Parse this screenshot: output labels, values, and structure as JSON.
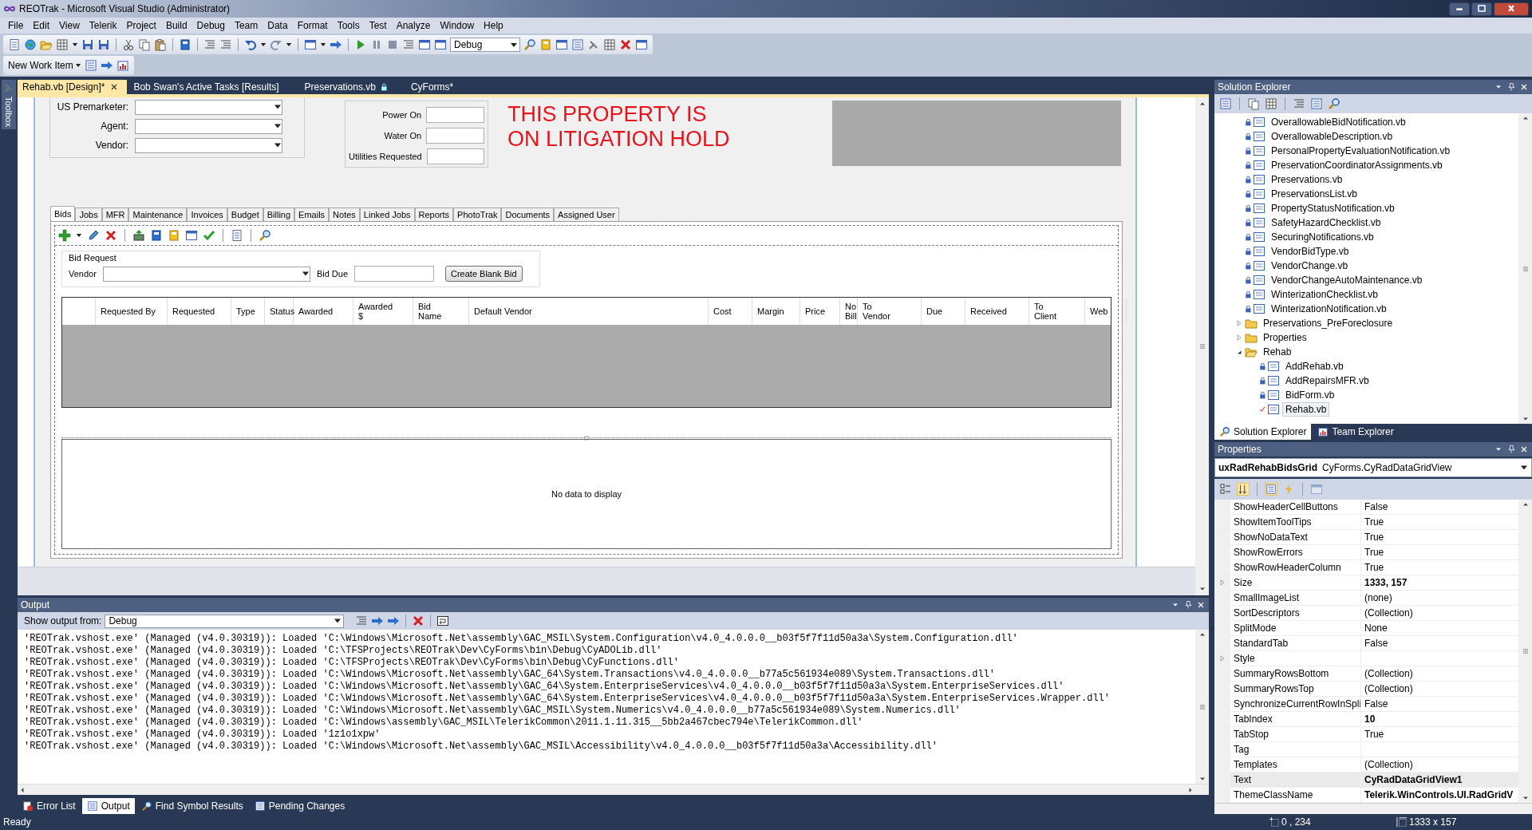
{
  "window": {
    "title": "REOTrak - Microsoft Visual Studio (Administrator)"
  },
  "menu": [
    "File",
    "Edit",
    "View",
    "Telerik",
    "Project",
    "Build",
    "Debug",
    "Team",
    "Data",
    "Format",
    "Tools",
    "Test",
    "Analyze",
    "Window",
    "Help"
  ],
  "toolbar": {
    "configuration": "Debug",
    "new_work_item": "New Work Item"
  },
  "toolbox": {
    "label": "Toolbox"
  },
  "document_tabs": [
    {
      "label": "Rehab.vb [Design]*",
      "selected": true,
      "locked": false
    },
    {
      "label": "Bob Swan's Active Tasks [Results]",
      "selected": false,
      "locked": false
    },
    {
      "label": "Preservations.vb",
      "selected": false,
      "locked": true
    },
    {
      "label": "CyForms*",
      "selected": false,
      "locked": false
    }
  ],
  "designer": {
    "assignment_fields": [
      "US Premarketer:",
      "Agent:",
      "Vendor:"
    ],
    "utility_fields": [
      "Power On",
      "Water On",
      "Utilities Requested"
    ],
    "alert": "THIS PROPERTY IS\nON LITIGATION HOLD",
    "tabs": [
      {
        "label": "Bids",
        "selected": true
      },
      {
        "label": "Jobs",
        "selected": false
      },
      {
        "label": "MFR",
        "selected": false
      },
      {
        "label": "Maintenance",
        "selected": false
      },
      {
        "label": "Invoices",
        "selected": false
      },
      {
        "label": "Budget",
        "selected": false
      },
      {
        "label": "Billing",
        "selected": false
      },
      {
        "label": "Emails",
        "selected": false
      },
      {
        "label": "Notes",
        "selected": false
      },
      {
        "label": "Linked Jobs",
        "selected": false
      },
      {
        "label": "Reports",
        "selected": false
      },
      {
        "label": "PhotoTrak",
        "selected": false
      },
      {
        "label": "Documents",
        "selected": false
      },
      {
        "label": "Assigned User",
        "selected": false
      }
    ],
    "bid_request": {
      "title": "Bid Request",
      "vendor_label": "Vendor",
      "bid_due_label": "Bid Due",
      "button": "Create Blank Bid"
    },
    "grid_columns": [
      "Requested By",
      "Requested",
      "Type",
      "Status",
      "Awarded",
      "Awarded\n$",
      "Bid\nName",
      "Default Vendor",
      "Cost",
      "Margin",
      "Price",
      "No\nBill",
      "To\nVendor",
      "Due",
      "Received",
      "To\nClient",
      "Web"
    ],
    "empty_grid_text": "No data to display"
  },
  "output": {
    "title": "Output",
    "source_label": "Show output from:",
    "source": "Debug",
    "lines": [
      "'REOTrak.vshost.exe' (Managed (v4.0.30319)): Loaded 'C:\\Windows\\Microsoft.Net\\assembly\\GAC_MSIL\\System.Configuration\\v4.0_4.0.0.0__b03f5f7f11d50a3a\\System.Configuration.dll'",
      "'REOTrak.vshost.exe' (Managed (v4.0.30319)): Loaded 'C:\\TFSProjects\\REOTrak\\Dev\\CyForms\\bin\\Debug\\CyADOLib.dll'",
      "'REOTrak.vshost.exe' (Managed (v4.0.30319)): Loaded 'C:\\TFSProjects\\REOTrak\\Dev\\CyForms\\bin\\Debug\\CyFunctions.dll'",
      "'REOTrak.vshost.exe' (Managed (v4.0.30319)): Loaded 'C:\\Windows\\Microsoft.Net\\assembly\\GAC_64\\System.Transactions\\v4.0_4.0.0.0__b77a5c561934e089\\System.Transactions.dll'",
      "'REOTrak.vshost.exe' (Managed (v4.0.30319)): Loaded 'C:\\Windows\\Microsoft.Net\\assembly\\GAC_64\\System.EnterpriseServices\\v4.0_4.0.0.0__b03f5f7f11d50a3a\\System.EnterpriseServices.dll'",
      "'REOTrak.vshost.exe' (Managed (v4.0.30319)): Loaded 'C:\\Windows\\Microsoft.Net\\assembly\\GAC_64\\System.EnterpriseServices\\v4.0_4.0.0.0__b03f5f7f11d50a3a\\System.EnterpriseServices.Wrapper.dll'",
      "'REOTrak.vshost.exe' (Managed (v4.0.30319)): Loaded 'C:\\Windows\\Microsoft.Net\\assembly\\GAC_MSIL\\System.Numerics\\v4.0_4.0.0.0__b77a5c561934e089\\System.Numerics.dll'",
      "'REOTrak.vshost.exe' (Managed (v4.0.30319)): Loaded 'C:\\Windows\\assembly\\GAC_MSIL\\TelerikCommon\\2011.1.11.315__5bb2a467cbec794e\\TelerikCommon.dll'",
      "'REOTrak.vshost.exe' (Managed (v4.0.30319)): Loaded '1z1o1xpw'",
      "'REOTrak.vshost.exe' (Managed (v4.0.30319)): Loaded 'C:\\Windows\\Microsoft.Net\\assembly\\GAC_MSIL\\Accessibility\\v4.0_4.0.0.0__b03f5f7f11d50a3a\\Accessibility.dll'"
    ]
  },
  "bottom_tabs": [
    {
      "label": "Error List",
      "selected": false
    },
    {
      "label": "Output",
      "selected": true
    },
    {
      "label": "Find Symbol Results",
      "selected": false
    },
    {
      "label": "Pending Changes",
      "selected": false
    }
  ],
  "solution_explorer": {
    "title": "Solution Explorer",
    "tree": [
      {
        "kind": "file",
        "label": "OverallowableBidNotification.vb",
        "locked": true,
        "checked_out": false,
        "selected": false
      },
      {
        "kind": "file",
        "label": "OverallowableDescription.vb",
        "locked": true,
        "checked_out": false,
        "selected": false
      },
      {
        "kind": "file",
        "label": "PersonalPropertyEvaluationNotification.vb",
        "locked": true,
        "checked_out": false,
        "selected": false
      },
      {
        "kind": "file",
        "label": "PreservationCoordinatorAssignments.vb",
        "locked": true,
        "checked_out": false,
        "selected": false
      },
      {
        "kind": "file",
        "label": "Preservations.vb",
        "locked": true,
        "checked_out": false,
        "selected": false
      },
      {
        "kind": "file",
        "label": "PreservationsList.vb",
        "locked": true,
        "checked_out": false,
        "selected": false
      },
      {
        "kind": "file",
        "label": "PropertyStatusNotification.vb",
        "locked": true,
        "checked_out": false,
        "selected": false
      },
      {
        "kind": "file",
        "label": "SafetyHazardChecklist.vb",
        "locked": true,
        "checked_out": false,
        "selected": false
      },
      {
        "kind": "file",
        "label": "SecuringNotifications.vb",
        "locked": true,
        "checked_out": false,
        "selected": false
      },
      {
        "kind": "file",
        "label": "VendorBidType.vb",
        "locked": true,
        "checked_out": false,
        "selected": false
      },
      {
        "kind": "file",
        "label": "VendorChange.vb",
        "locked": true,
        "checked_out": false,
        "selected": false
      },
      {
        "kind": "file",
        "label": "VendorChangeAutoMaintenance.vb",
        "locked": true,
        "checked_out": false,
        "selected": false
      },
      {
        "kind": "file",
        "label": "WinterizationChecklist.vb",
        "locked": true,
        "checked_out": false,
        "selected": false
      },
      {
        "kind": "file",
        "label": "WinterizationNotification.vb",
        "locked": true,
        "checked_out": false,
        "selected": false
      },
      {
        "kind": "folder",
        "label": "Preservations_PreForeclosure",
        "expanded": false,
        "selected": false
      },
      {
        "kind": "folder",
        "label": "Properties",
        "expanded": false,
        "selected": false
      },
      {
        "kind": "folder",
        "label": "Rehab",
        "expanded": true,
        "selected": false,
        "children": [
          {
            "kind": "file",
            "label": "AddRehab.vb",
            "locked": true,
            "checked_out": false,
            "selected": false
          },
          {
            "kind": "file",
            "label": "AddRepairsMFR.vb",
            "locked": true,
            "checked_out": false,
            "selected": false
          },
          {
            "kind": "file",
            "label": "BidForm.vb",
            "locked": true,
            "checked_out": false,
            "selected": false
          },
          {
            "kind": "file",
            "label": "Rehab.vb",
            "locked": false,
            "checked_out": true,
            "selected": true
          }
        ]
      }
    ]
  },
  "explorer_tabs": [
    {
      "label": "Solution Explorer",
      "selected": true
    },
    {
      "label": "Team Explorer",
      "selected": false
    }
  ],
  "properties": {
    "title": "Properties",
    "object_name": "uxRadRehabBidsGrid",
    "object_type": "CyForms.CyRadDataGridView",
    "rows": [
      {
        "name": "ShowHeaderCellButtons",
        "value": "False",
        "modified": false,
        "expandable": false,
        "selected": false
      },
      {
        "name": "ShowItemToolTips",
        "value": "True",
        "modified": false,
        "expandable": false,
        "selected": false
      },
      {
        "name": "ShowNoDataText",
        "value": "True",
        "modified": false,
        "expandable": false,
        "selected": false
      },
      {
        "name": "ShowRowErrors",
        "value": "True",
        "modified": false,
        "expandable": false,
        "selected": false
      },
      {
        "name": "ShowRowHeaderColumn",
        "value": "True",
        "modified": false,
        "expandable": false,
        "selected": false
      },
      {
        "name": "Size",
        "value": "1333, 157",
        "modified": true,
        "expandable": true,
        "selected": false
      },
      {
        "name": "SmallImageList",
        "value": "(none)",
        "modified": false,
        "expandable": false,
        "selected": false
      },
      {
        "name": "SortDescriptors",
        "value": "(Collection)",
        "modified": false,
        "expandable": false,
        "selected": false
      },
      {
        "name": "SplitMode",
        "value": "None",
        "modified": false,
        "expandable": false,
        "selected": false
      },
      {
        "name": "StandardTab",
        "value": "False",
        "modified": false,
        "expandable": false,
        "selected": false
      },
      {
        "name": "Style",
        "expandable": true,
        "selected": false
      },
      {
        "name": "SummaryRowsBottom",
        "value": "(Collection)",
        "modified": false,
        "expandable": false,
        "selected": false
      },
      {
        "name": "SummaryRowsTop",
        "value": "(Collection)",
        "modified": false,
        "expandable": false,
        "selected": false
      },
      {
        "name": "SynchronizeCurrentRowInSpli",
        "value": "False",
        "modified": false,
        "expandable": false,
        "selected": false
      },
      {
        "name": "TabIndex",
        "value": "10",
        "modified": true,
        "expandable": false,
        "selected": false
      },
      {
        "name": "TabStop",
        "value": "True",
        "modified": false,
        "expandable": false,
        "selected": false
      },
      {
        "name": "Tag",
        "expandable": false,
        "selected": false
      },
      {
        "name": "Templates",
        "value": "(Collection)",
        "modified": false,
        "expandable": false,
        "selected": false
      },
      {
        "name": "Text",
        "value": "CyRadDataGridView1",
        "modified": true,
        "expandable": false,
        "selected": true
      },
      {
        "name": "ThemeClassName",
        "value": "Telerik.WinControls.UI.RadGridV",
        "modified": true,
        "expandable": false,
        "selected": false
      }
    ]
  },
  "status_bar": {
    "text": "Ready",
    "position": "0 , 234",
    "size": "1333 x 157"
  }
}
